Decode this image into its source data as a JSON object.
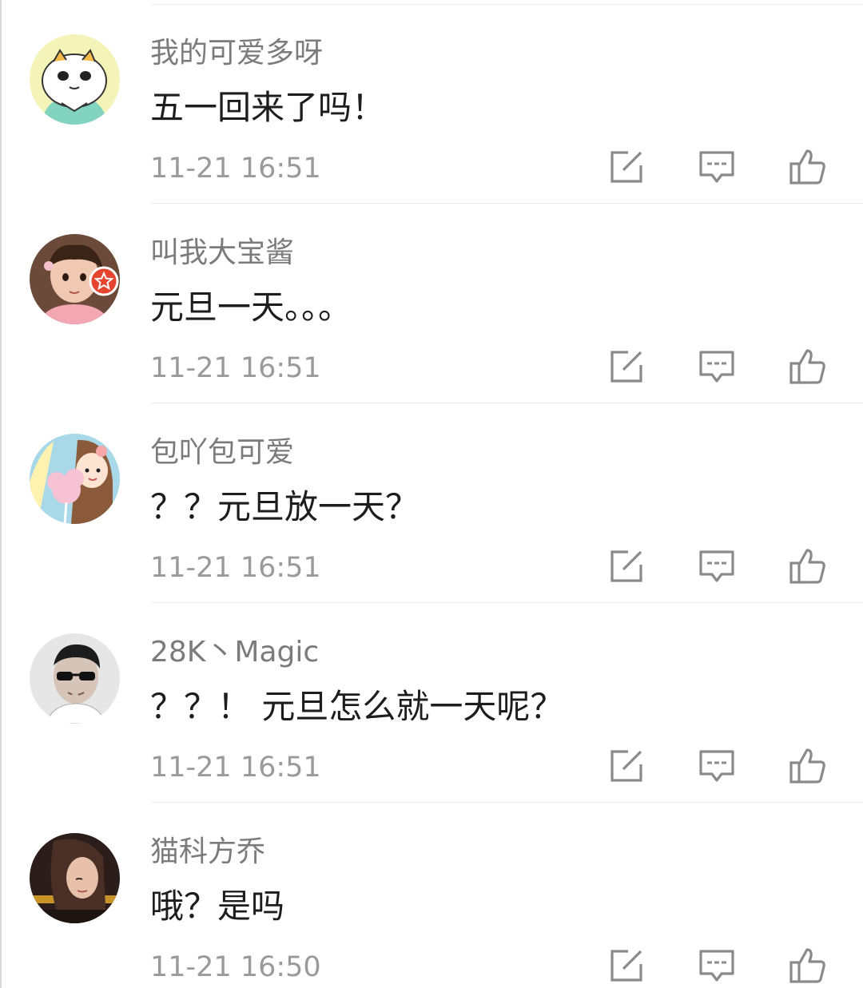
{
  "comments": [
    {
      "username": "我的可爱多呀",
      "content": "五一回来了吗！",
      "time": "11-21 16:51"
    },
    {
      "username": "叫我大宝酱",
      "content": "元旦一天。。。",
      "time": "11-21 16:51"
    },
    {
      "username": "包吖包可爱",
      "content": "？？元旦放一天？",
      "time": "11-21 16:51"
    },
    {
      "username": "28K丶Magic",
      "content": "？？！ 元旦怎么就一天呢？",
      "time": "11-21 16:51"
    },
    {
      "username": "猫科方乔",
      "content": "哦？是吗",
      "time": "11-21 16:50"
    }
  ],
  "icons": {
    "repost": "edit-repost-icon",
    "reply": "comment-icon",
    "like": "thumbs-up-icon",
    "verified": "star-badge-icon"
  },
  "colors": {
    "text_primary": "#1d1d1d",
    "text_secondary": "#7b7b7b",
    "icon": "#8a8a8a",
    "badge": "#e5452f"
  }
}
